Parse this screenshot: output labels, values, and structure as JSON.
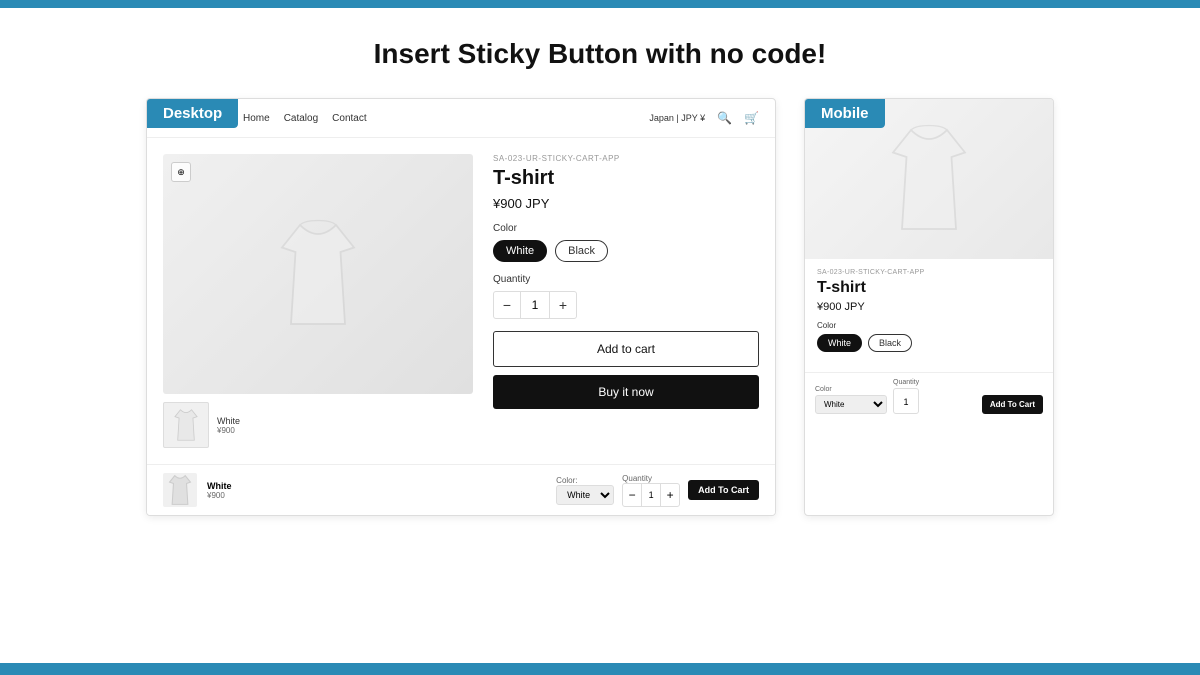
{
  "page": {
    "title": "Insert Sticky Button with no code!",
    "top_bar_color": "#2a8ab5",
    "bottom_bar_color": "#2a8ab5",
    "bg_color": "#1a1a1a",
    "content_bg": "#ffffff"
  },
  "desktop_preview": {
    "label": "Desktop",
    "nav": {
      "links": [
        "Home",
        "Catalog",
        "Contact"
      ],
      "region": "Japan | JPY ¥"
    },
    "product": {
      "app_label": "SA-023-UR-STICKY-CART-APP",
      "name": "T-shirt",
      "price": "¥900 JPY",
      "color_label": "Color",
      "colors": [
        "White",
        "Black"
      ],
      "active_color": "White",
      "quantity_label": "Quantity",
      "quantity": "1",
      "add_to_cart": "Add to cart",
      "buy_now": "Buy it now"
    },
    "sticky_bar": {
      "product_name": "White",
      "price": "¥900",
      "color_label": "Color:",
      "color_value": "White",
      "qty_label": "Quantity",
      "qty_value": "1",
      "button_label": "Add To Cart",
      "color_options": [
        "White"
      ]
    }
  },
  "mobile_preview": {
    "label": "Mobile",
    "product": {
      "app_label": "SA-023-UR-STICKY-CART-APP",
      "name": "T-shirt",
      "price": "¥900 JPY",
      "color_label": "Color",
      "colors": [
        "White",
        "Black"
      ],
      "active_color": "White"
    },
    "sticky_bar": {
      "color_label": "Color",
      "color_value": "White",
      "qty_label": "Quantity",
      "qty_value": "1",
      "button_label": "Add To Cart",
      "color_options": [
        "White"
      ]
    }
  }
}
